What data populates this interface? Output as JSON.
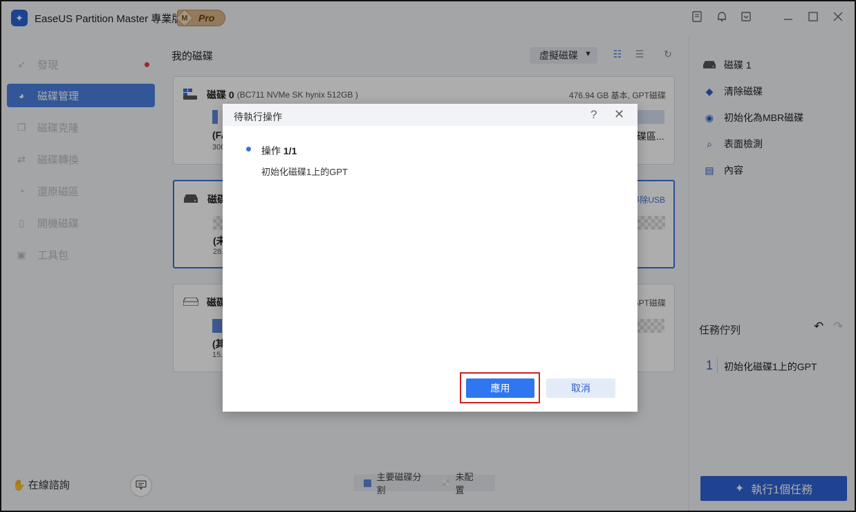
{
  "app": {
    "title": "EaseUS Partition Master 專業版",
    "logo_letter": "✦",
    "badge_m": "M",
    "badge_pro": "Pro",
    "icons": [
      "feedback-icon",
      "notification-icon",
      "download-icon",
      "minimize-icon",
      "maximize-icon",
      "close-icon"
    ]
  },
  "sidebar": {
    "items": [
      {
        "label": "發現",
        "icon": "rocket-icon"
      },
      {
        "label": "磁碟管理",
        "icon": "pie-chart-icon"
      },
      {
        "label": "磁碟克隆",
        "icon": "clone-icon"
      },
      {
        "label": "磁碟轉換",
        "icon": "convert-icon"
      },
      {
        "label": "還原磁區",
        "icon": "recover-icon"
      },
      {
        "label": "開機磁碟",
        "icon": "usb-icon"
      },
      {
        "label": "工具包",
        "icon": "toolbox-icon"
      }
    ],
    "consult_label": "在線諮詢"
  },
  "main": {
    "title": "我的磁碟",
    "virtual_disk_label": "虛擬磁碟",
    "disks": [
      {
        "name": "磁碟 0",
        "sub": "(BC711 NVMe SK hynix 512GB )",
        "right": "476.94 GB 基本, GPT磁碟",
        "part_label": "(FA",
        "part_size": "300",
        "right_part": "碟區..."
      },
      {
        "name": "磁碟",
        "right": "移除USB",
        "part_label": "(未",
        "part_size": "28."
      },
      {
        "name": "磁碟",
        "right": "GPT磁碟",
        "part_label": "(其",
        "part_size": "15."
      }
    ],
    "legend": {
      "primary": "主要磁碟分割",
      "unallocated": "未配置"
    }
  },
  "right_panel": {
    "disk_label": "磁碟 1",
    "actions": [
      "清除磁碟",
      "初始化為MBR磁碟",
      "表面檢測",
      "內容"
    ],
    "queue_title": "任務佇列",
    "queue_items": [
      {
        "num": "1",
        "text": "初始化磁碟1上的GPT"
      }
    ],
    "execute_label": "執行1個任務"
  },
  "modal": {
    "title": "待執行操作",
    "op_prefix": "操作 ",
    "op_count": "1/1",
    "op_desc": "初始化磁碟1上的GPT",
    "apply_label": "應用",
    "cancel_label": "取消"
  }
}
